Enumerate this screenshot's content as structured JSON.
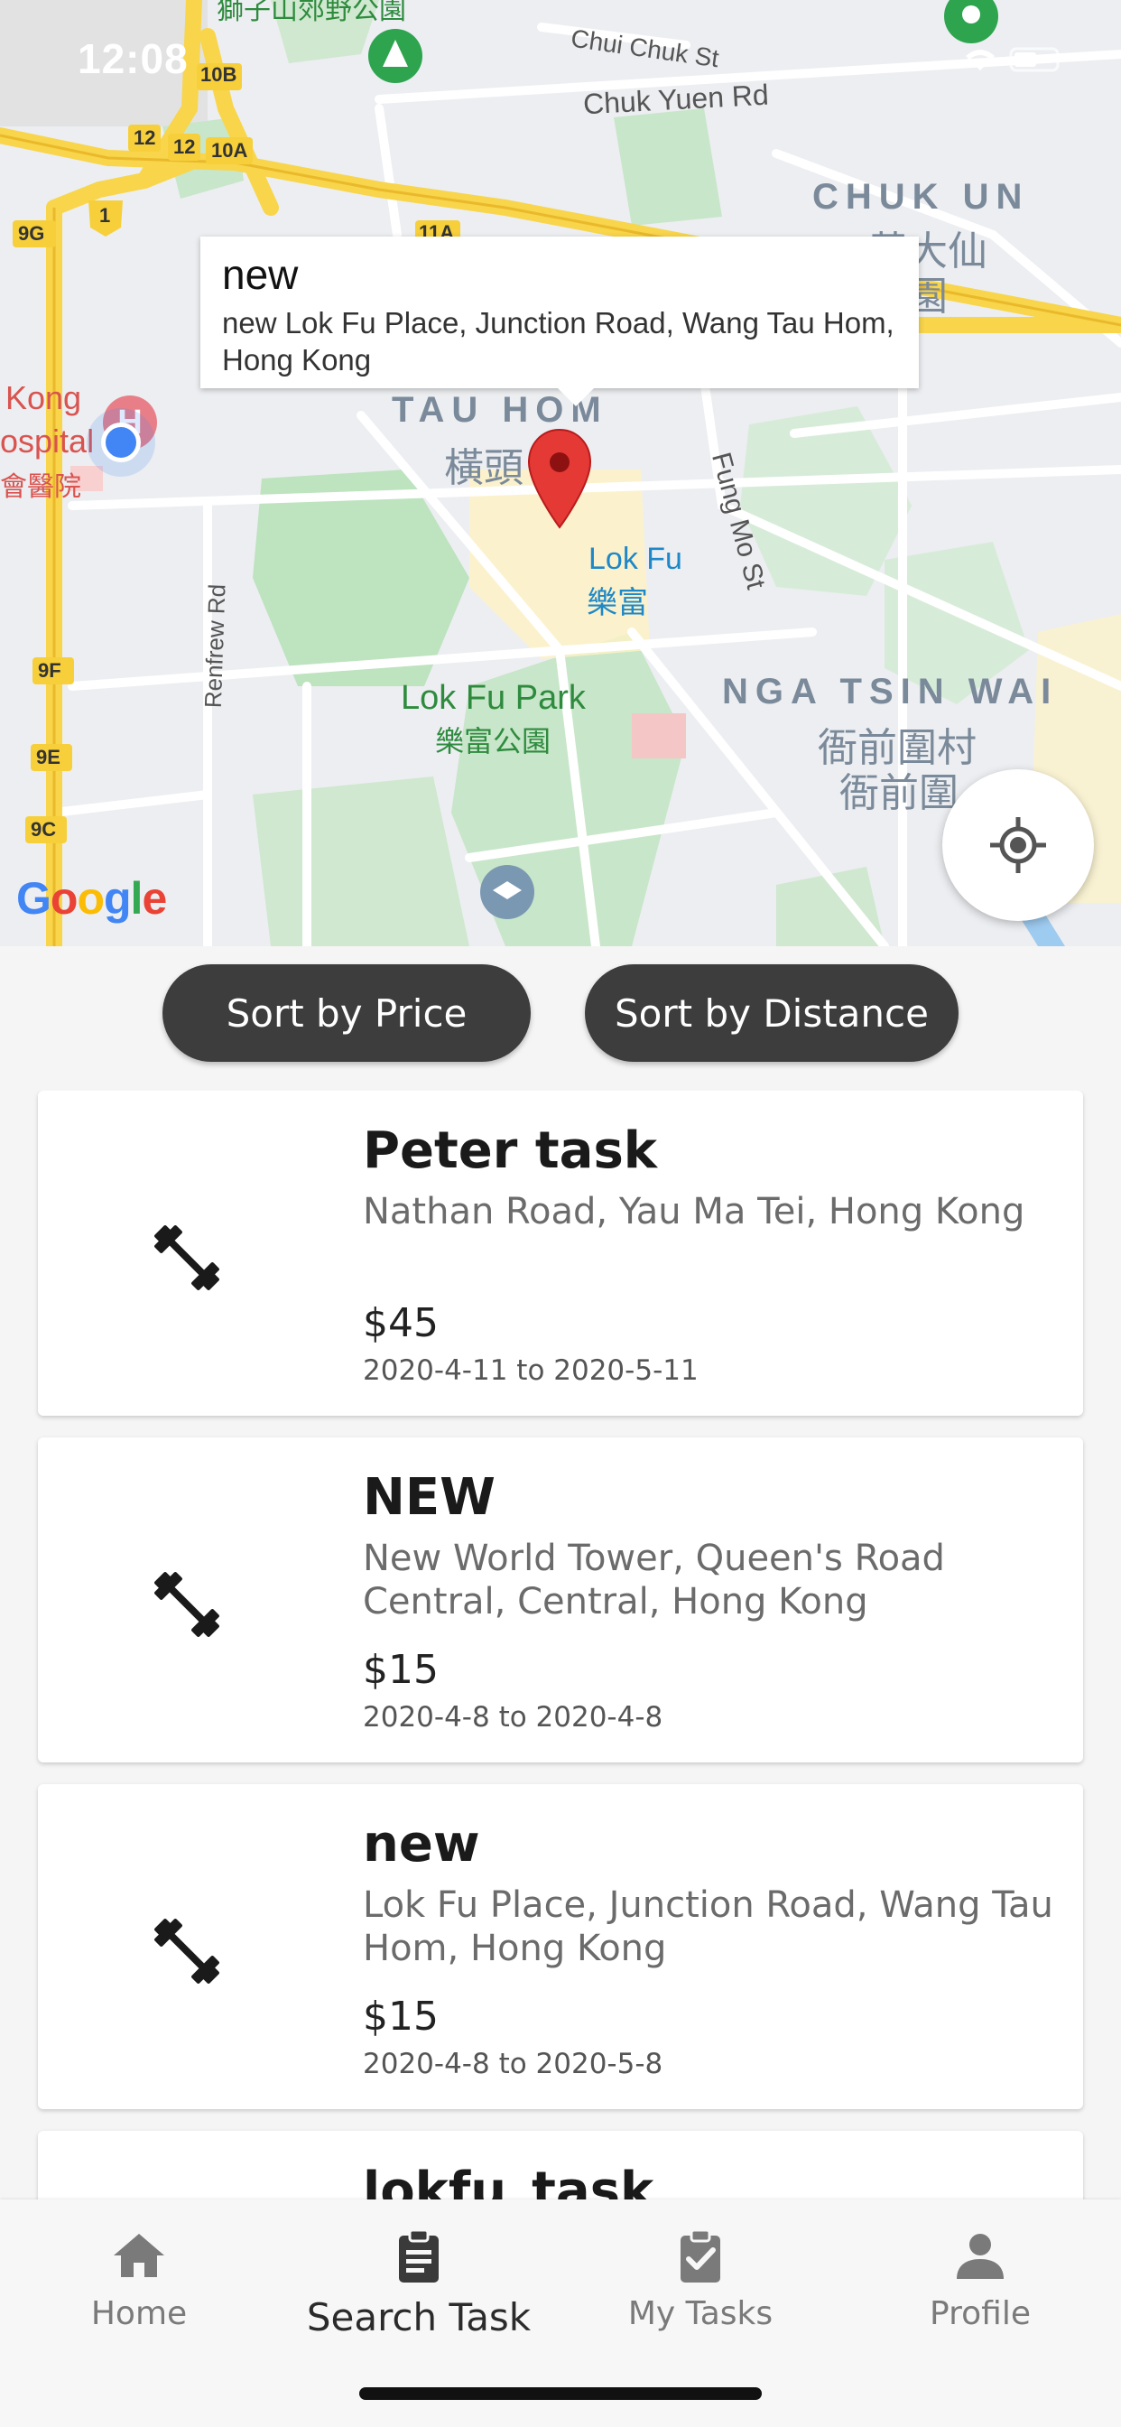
{
  "status_bar": {
    "time": "12:08"
  },
  "map": {
    "labels": {
      "park_top": "獅子山郊野公園",
      "chui_chuk_st": "Chui Chuk St",
      "chuk_yuen_rd": "Chuk Yuen Rd",
      "chuk_un": "CHUK UN",
      "chuk_un_cjk_1": "黃大仙",
      "chuk_un_cjk_2": "竹園",
      "route_10b": "10B",
      "route_12a": "12",
      "route_12b": "12",
      "route_10a": "10A",
      "route_1": "1",
      "route_9g": "9G",
      "route_11a": "11A",
      "route_9f": "9F",
      "route_9e": "9E",
      "route_9c": "9C",
      "hospital_en_1": "Kong",
      "hospital_en_2": "ospital",
      "hospital_cjk": "會醫院",
      "tau_hom": "TAU HOM",
      "tau_hom_cjk": "橫頭",
      "fung_mo_st": "Fung Mo St",
      "lok_fu": "Lok Fu",
      "lok_fu_cjk": "樂富",
      "renfrew_rd": "Renfrew Rd",
      "lok_fu_park": "Lok Fu Park",
      "lok_fu_park_cjk": "樂富公園",
      "nga_tsin_wai": "NGA TSIN WAI",
      "nga_tsin_wai_cjk_1": "衙前圍村",
      "nga_tsin_wai_cjk_2": "衙前圍",
      "google": "Google"
    },
    "callout": {
      "title": "new",
      "snippet": "new Lok Fu Place, Junction Road, Wang Tau Hom, Hong Kong"
    },
    "marker_color": "#e53935",
    "locate_icon": "my-location-icon"
  },
  "sort": {
    "price_label": "Sort by Price",
    "distance_label": "Sort by Distance"
  },
  "tasks": [
    {
      "title": "Peter task",
      "address": "Nathan Road, Yau Ma Tei, Hong Kong",
      "price": "$45",
      "dates": "2020-4-11 to 2020-5-11",
      "icon": "dumbbell-icon"
    },
    {
      "title": "NEW",
      "address": "New World Tower, Queen's Road Central, Central, Hong Kong",
      "price": "$15",
      "dates": "2020-4-8 to 2020-4-8",
      "icon": "dumbbell-icon"
    },
    {
      "title": "new",
      "address": "Lok Fu Place, Junction Road, Wang Tau Hom, Hong Kong",
      "price": "$15",
      "dates": "2020-4-8 to 2020-5-8",
      "icon": "dumbbell-icon"
    },
    {
      "title": "lokfu_task",
      "address": "",
      "price": "",
      "dates": "",
      "icon": "dumbbell-icon"
    }
  ],
  "nav": {
    "items": [
      {
        "label": "Home",
        "icon": "home-icon",
        "active": false
      },
      {
        "label": "Search Task",
        "icon": "clipboard-icon",
        "active": true
      },
      {
        "label": "My Tasks",
        "icon": "clipboard-check-icon",
        "active": false
      },
      {
        "label": "Profile",
        "icon": "person-icon",
        "active": false
      }
    ]
  }
}
